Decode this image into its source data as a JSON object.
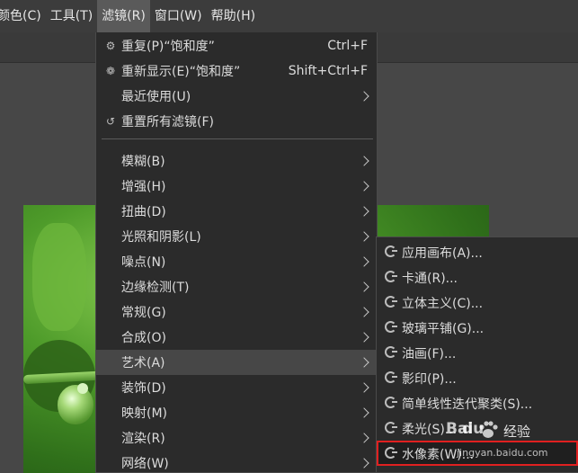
{
  "menubar": {
    "items": [
      {
        "label": "颜色(C)"
      },
      {
        "label": "工具(T)"
      },
      {
        "label": "滤镜(R)"
      },
      {
        "label": "窗口(W)"
      },
      {
        "label": "帮助(H)"
      }
    ]
  },
  "filters_menu": {
    "repeat": {
      "label": "重复(P)“饱和度”",
      "shortcut": "Ctrl+F"
    },
    "reshow": {
      "label": "重新显示(E)“饱和度”",
      "shortcut": "Shift+Ctrl+F"
    },
    "recent": {
      "label": "最近使用(U)"
    },
    "reset": {
      "label": "重置所有滤镜(F)"
    },
    "categories": [
      {
        "label": "模糊(B)"
      },
      {
        "label": "增强(H)"
      },
      {
        "label": "扭曲(D)"
      },
      {
        "label": "光照和阴影(L)"
      },
      {
        "label": "噪点(N)"
      },
      {
        "label": "边缘检测(T)"
      },
      {
        "label": "常规(G)"
      },
      {
        "label": "合成(O)"
      },
      {
        "label": "艺术(A)"
      },
      {
        "label": "装饰(D)"
      },
      {
        "label": "映射(M)"
      },
      {
        "label": "渲染(R)"
      },
      {
        "label": "网络(W)"
      }
    ]
  },
  "artistic_submenu": {
    "items": [
      {
        "label": "应用画布(A)..."
      },
      {
        "label": "卡通(R)..."
      },
      {
        "label": "立体主义(C)..."
      },
      {
        "label": "玻璃平铺(G)..."
      },
      {
        "label": "油画(F)..."
      },
      {
        "label": "影印(P)..."
      },
      {
        "label": "简单线性迭代聚类(S)..."
      },
      {
        "label": "柔光(S)..."
      },
      {
        "label": "水像素(W)..."
      }
    ]
  },
  "watermark": {
    "brand": "Bai",
    "brand2": "du",
    "text": "经验",
    "url": "jingyan.baidu.com"
  },
  "colors": {
    "highlight_border": "#e02020",
    "menu_bg": "#2b2b2b"
  }
}
